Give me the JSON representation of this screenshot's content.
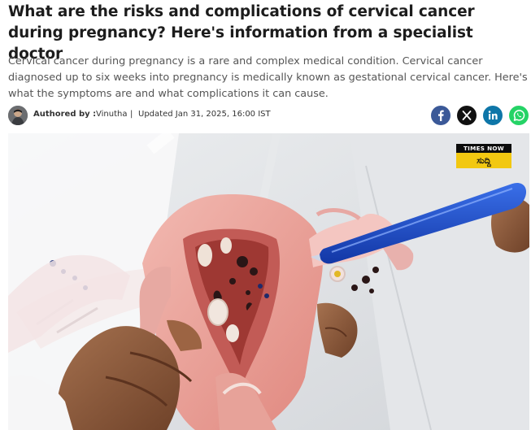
{
  "article": {
    "headline": "What are the risks and complications of cervical cancer during pregnancy? Here's information from a specialist doctor",
    "summary": "Cervical cancer during pregnancy is a rare and complex medical condition. Cervical cancer diagnosed up to six weeks into pregnancy is medically known as gestational cervical cancer. Here's what the symptoms are and what complications it can cause.",
    "byline": {
      "label": "Authored by :",
      "author": "Vinutha",
      "separator": "|",
      "updated": "Updated Jan 31, 2025, 16:00 IST"
    },
    "share": [
      {
        "network": "facebook",
        "icon": "facebook-icon",
        "color": "#3b5998"
      },
      {
        "network": "x",
        "icon": "x-icon",
        "color": "#111111"
      },
      {
        "network": "linkedin",
        "icon": "linkedin-icon",
        "color": "#0e76a8"
      },
      {
        "network": "whatsapp",
        "icon": "whatsapp-icon",
        "color": "#25d366"
      }
    ],
    "hero": {
      "badge_top": "TIMES NOW",
      "badge_bottom": "ಸುದ್ದಿ"
    }
  }
}
